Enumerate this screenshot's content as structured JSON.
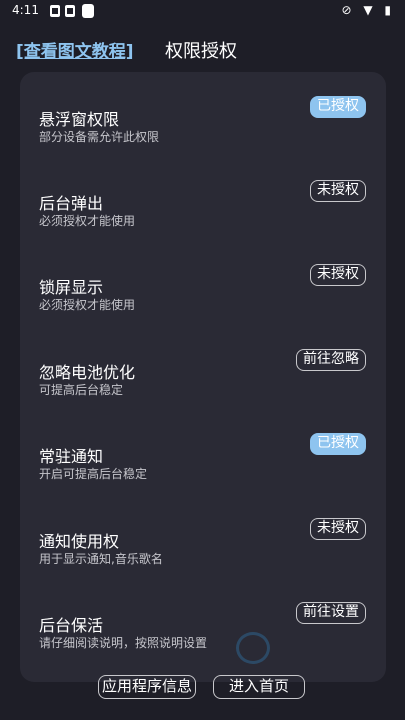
{
  "statusbar": {
    "time": "4:11",
    "right_icons": "⊘ ▼ ▮"
  },
  "header": {
    "link": "[查看图文教程]",
    "title": "权限授权"
  },
  "permissions": [
    {
      "title": "悬浮窗权限",
      "desc": "部分设备需允许此权限",
      "button": "已授权",
      "granted": true
    },
    {
      "title": "后台弹出",
      "desc": "必须授权才能使用",
      "button": "未授权",
      "granted": false
    },
    {
      "title": "锁屏显示",
      "desc": "必须授权才能使用",
      "button": "未授权",
      "granted": false
    },
    {
      "title": "忽略电池优化",
      "desc": "可提高后台稳定",
      "button": "前往忽略",
      "granted": false
    },
    {
      "title": "常驻通知",
      "desc": "开启可提高后台稳定",
      "button": "已授权",
      "granted": true
    },
    {
      "title": "通知使用权",
      "desc": "用于显示通知,音乐歌名",
      "button": "未授权",
      "granted": false
    },
    {
      "title": "后台保活",
      "desc": "请仔细阅读说明，按照说明设置",
      "button": "前往设置",
      "granted": false
    }
  ],
  "footer": {
    "app_info": "应用程序信息",
    "enter_home": "进入首页"
  },
  "colors": {
    "background": "#1e1e27",
    "card": "#2a2a35",
    "accent": "#8ec4ef"
  }
}
